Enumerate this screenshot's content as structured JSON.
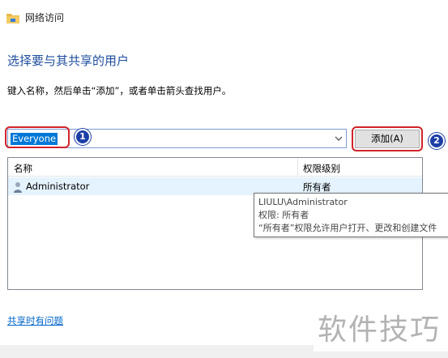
{
  "window": {
    "title": "网络访问"
  },
  "heading": "选择要与其共享的用户",
  "instruction": "键入名称，然后单击“添加”，或者单击箭头查找用户。",
  "user_input": {
    "value": "Everyone"
  },
  "add_button": {
    "label": "添加(A)"
  },
  "badges": [
    "1",
    "2"
  ],
  "list": {
    "columns": [
      "名称",
      "权限级别"
    ],
    "rows": [
      {
        "name": "Administrator",
        "permission": "所有者"
      }
    ]
  },
  "tooltip": {
    "line1": "LIULU\\Administrator",
    "line2": "权限: 所有者",
    "line3": "“所有者”权限允许用户打开、更改和创建文件"
  },
  "help_link": "共享时有问题",
  "watermark": "软件技巧",
  "colors": {
    "accent": "#0078d7",
    "heading": "#1f4e9e",
    "highlight": "#d1232a",
    "badge": "#1c3fa6"
  },
  "icons": {
    "title": "network-folder-icon",
    "dropdown": "chevron-down-icon",
    "user": "user-icon"
  }
}
